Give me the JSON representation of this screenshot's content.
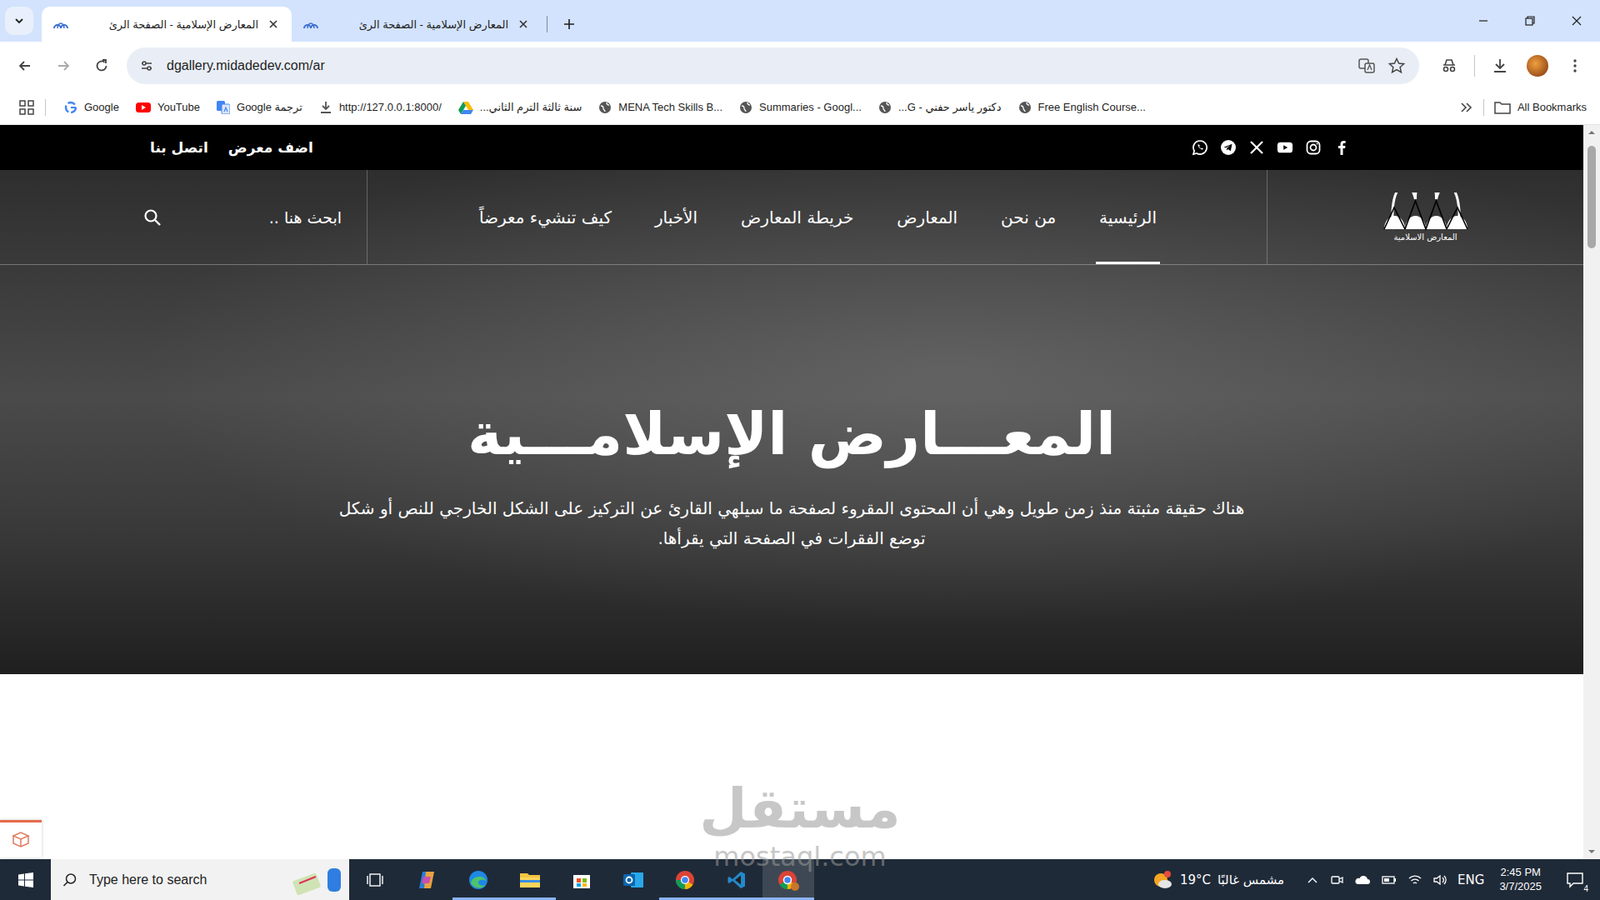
{
  "browser": {
    "tabs": [
      {
        "label": "المعارض الإسلامية - الصفحة الرئ",
        "selected": true
      },
      {
        "label": "المعارض الإسلامية - الصفحة الرئ",
        "selected": false
      }
    ],
    "address": "dgallery.midadedev.com/ar",
    "bookmarks": [
      {
        "label": "Google",
        "kind": "google"
      },
      {
        "label": "YouTube",
        "kind": "youtube"
      },
      {
        "label": "Google ترجمة",
        "kind": "translate"
      },
      {
        "label": "http://127.0.0.1:8000/",
        "kind": "download"
      },
      {
        "label": "سنة ثالثة الترم الثاني...",
        "kind": "drive"
      },
      {
        "label": "MENA Tech Skills B...",
        "kind": "globe"
      },
      {
        "label": "Summaries - Googl...",
        "kind": "globe"
      },
      {
        "label": "دكتور ياسر حفني - G...",
        "kind": "globe"
      },
      {
        "label": "Free English Course...",
        "kind": "globe"
      }
    ],
    "all_bookmarks": "All Bookmarks"
  },
  "site": {
    "logo_text": "المعارض الاسلامية",
    "top_links": [
      "اضف معرض",
      "اتصل بنا"
    ],
    "nav": [
      {
        "label": "الرئيسية",
        "selected": true
      },
      {
        "label": "من نحن",
        "selected": false
      },
      {
        "label": "المعارض",
        "selected": false
      },
      {
        "label": "خريطة المعارض",
        "selected": false
      },
      {
        "label": "الأخبار",
        "selected": false
      },
      {
        "label": "كيف تنشيء معرضاً",
        "selected": false
      }
    ],
    "search_placeholder": "ابحث هنا ..",
    "hero_title": "المعـــارض الإسلامـــية",
    "hero_text": "هناك حقيقة مثبتة منذ زمن طويل وهي أن المحتوى المقروء لصفحة ما سيلهي القارئ عن التركيز على الشكل الخارجي للنص أو شكل توضع الفقرات في الصفحة التي يقرأها."
  },
  "watermark": {
    "logo": "مستقل",
    "domain": "mostaql.com"
  },
  "taskbar": {
    "search_placeholder": "Type here to search",
    "apps": [
      {
        "kind": "task-view",
        "running": false,
        "selected": false
      },
      {
        "kind": "copilot",
        "running": false,
        "selected": false
      },
      {
        "kind": "edge",
        "running": true,
        "selected": false
      },
      {
        "kind": "explorer",
        "running": true,
        "selected": false
      },
      {
        "kind": "store",
        "running": false,
        "selected": false
      },
      {
        "kind": "outlook",
        "running": false,
        "selected": false
      },
      {
        "kind": "chrome",
        "running": true,
        "selected": false
      },
      {
        "kind": "vscode",
        "running": true,
        "selected": false
      },
      {
        "kind": "chrome-profile",
        "running": true,
        "selected": true
      }
    ],
    "weather": {
      "temp": "19°C",
      "text": "مشمس غالبًا"
    },
    "language": "ENG",
    "time": "2:45 PM",
    "date": "3/7/2025",
    "notifications": "4"
  }
}
